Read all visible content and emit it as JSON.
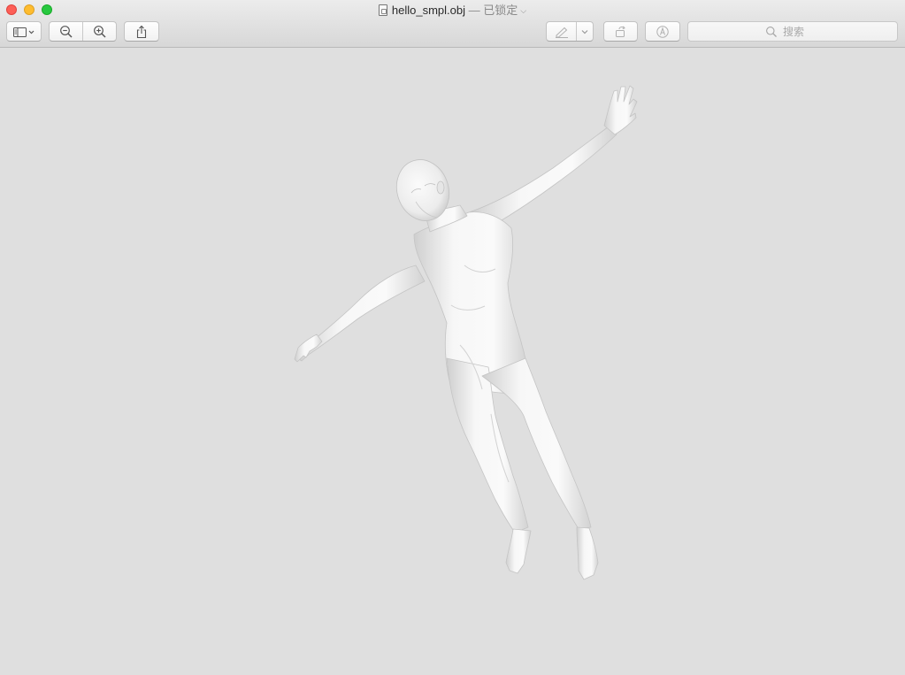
{
  "window": {
    "title": "hello_smpl.obj",
    "separator": "—",
    "status": "已锁定",
    "file_icon": "doc-icon"
  },
  "toolbar": {
    "sidebar_icon": "sidebar-icon",
    "zoom_out_icon": "zoom-out-icon",
    "zoom_in_icon": "zoom-in-icon",
    "share_icon": "share-icon",
    "markup_icon": "pen-icon",
    "rotate_icon": "rotate-icon",
    "annotate_icon": "annotate-icon"
  },
  "search": {
    "placeholder": "搜索",
    "icon": "search-icon"
  },
  "viewport": {
    "content": "3d-human-body-model",
    "background": "#dfdfdf"
  }
}
